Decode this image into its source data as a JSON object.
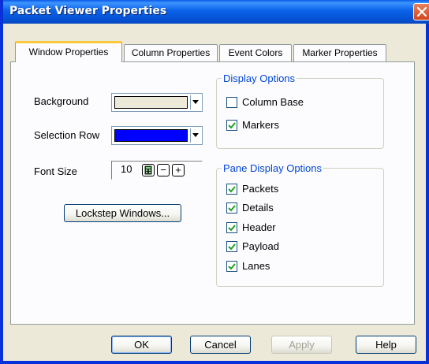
{
  "window": {
    "title": "Packet Viewer Properties"
  },
  "tabs": [
    {
      "label": "Window Properties",
      "active": true
    },
    {
      "label": "Column Properties",
      "active": false
    },
    {
      "label": "Event Colors",
      "active": false
    },
    {
      "label": "Marker Properties",
      "active": false
    }
  ],
  "window_props": {
    "background_label": "Background",
    "background_color": "#ece9d8",
    "selection_row_label": "Selection Row",
    "selection_row_color": "#0000ff",
    "font_size_label": "Font Size",
    "font_size_value": "10",
    "font_minus": "−",
    "font_plus": "+",
    "lockstep_button": "Lockstep Windows..."
  },
  "display_options": {
    "title": "Display Options",
    "items": [
      {
        "label": "Column Base",
        "checked": false
      },
      {
        "label": "Markers",
        "checked": true
      }
    ]
  },
  "pane_display_options": {
    "title": "Pane Display Options",
    "items": [
      {
        "label": "Packets",
        "checked": true
      },
      {
        "label": "Details",
        "checked": true
      },
      {
        "label": "Header",
        "checked": true
      },
      {
        "label": "Payload",
        "checked": true
      },
      {
        "label": "Lanes",
        "checked": true
      }
    ]
  },
  "buttons": {
    "ok": "OK",
    "cancel": "Cancel",
    "apply": "Apply",
    "help": "Help"
  },
  "colors": {
    "title_bar": "#0453d4",
    "group_title": "#0046d5",
    "check_mark": "#21a121",
    "active_tab_accent": "#ffc83c"
  }
}
